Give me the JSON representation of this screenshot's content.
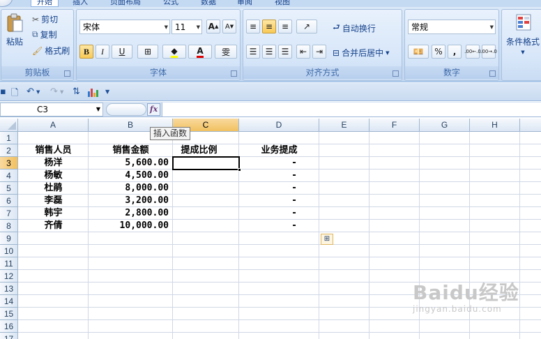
{
  "tabs": [
    "开始",
    "插入",
    "页面布局",
    "公式",
    "数据",
    "审阅",
    "视图"
  ],
  "ribbon": {
    "clipboard": {
      "paste": "粘贴",
      "cut": "剪切",
      "copy": "复制",
      "format_painter": "格式刷",
      "label": "剪贴板"
    },
    "font": {
      "name": "宋体",
      "size": "11",
      "bold": "B",
      "italic": "I",
      "underline": "U",
      "grow": "A",
      "shrink": "A",
      "font_color_glyph": "A",
      "wen": "雯",
      "label": "字体"
    },
    "alignment": {
      "wrap_text": "自动换行",
      "merge_center": "合并后居中",
      "label": "对齐方式"
    },
    "number": {
      "format": "常规",
      "percent": "%",
      "comma": ",",
      "inc_decimal": ".00←.0",
      "dec_decimal": ".00→.0",
      "label": "数字"
    },
    "styles": {
      "conditional_format": "条件格式"
    }
  },
  "formula_bar": {
    "name_box": "C3",
    "fx": "fx",
    "formula": ""
  },
  "tooltip": "插入函数",
  "grid": {
    "columns": [
      "A",
      "B",
      "C",
      "D",
      "E",
      "F",
      "G",
      "H"
    ],
    "selected_column": "C",
    "rows": [
      "1",
      "2",
      "3",
      "4",
      "5",
      "6",
      "7",
      "8",
      "9",
      "10",
      "11",
      "12",
      "13",
      "14",
      "15",
      "16",
      "17"
    ],
    "selected_row": "3",
    "headers": {
      "A": "销售人员",
      "B": "销售金额",
      "C": "提成比例",
      "D": "业务提成"
    },
    "data": [
      {
        "A": "杨洋",
        "B": "5,600.00",
        "C": "",
        "D": "-"
      },
      {
        "A": "杨敏",
        "B": "4,500.00",
        "C": "",
        "D": "-"
      },
      {
        "A": "杜鹃",
        "B": "8,000.00",
        "C": "",
        "D": "-"
      },
      {
        "A": "李磊",
        "B": "3,200.00",
        "C": "",
        "D": "-"
      },
      {
        "A": "韩宇",
        "B": "2,800.00",
        "C": "",
        "D": "-"
      },
      {
        "A": "齐倩",
        "B": "10,000.00",
        "C": "",
        "D": "-"
      }
    ]
  },
  "watermark": {
    "brand": "Baidu经验",
    "url": "jingyan.baidu.com"
  }
}
